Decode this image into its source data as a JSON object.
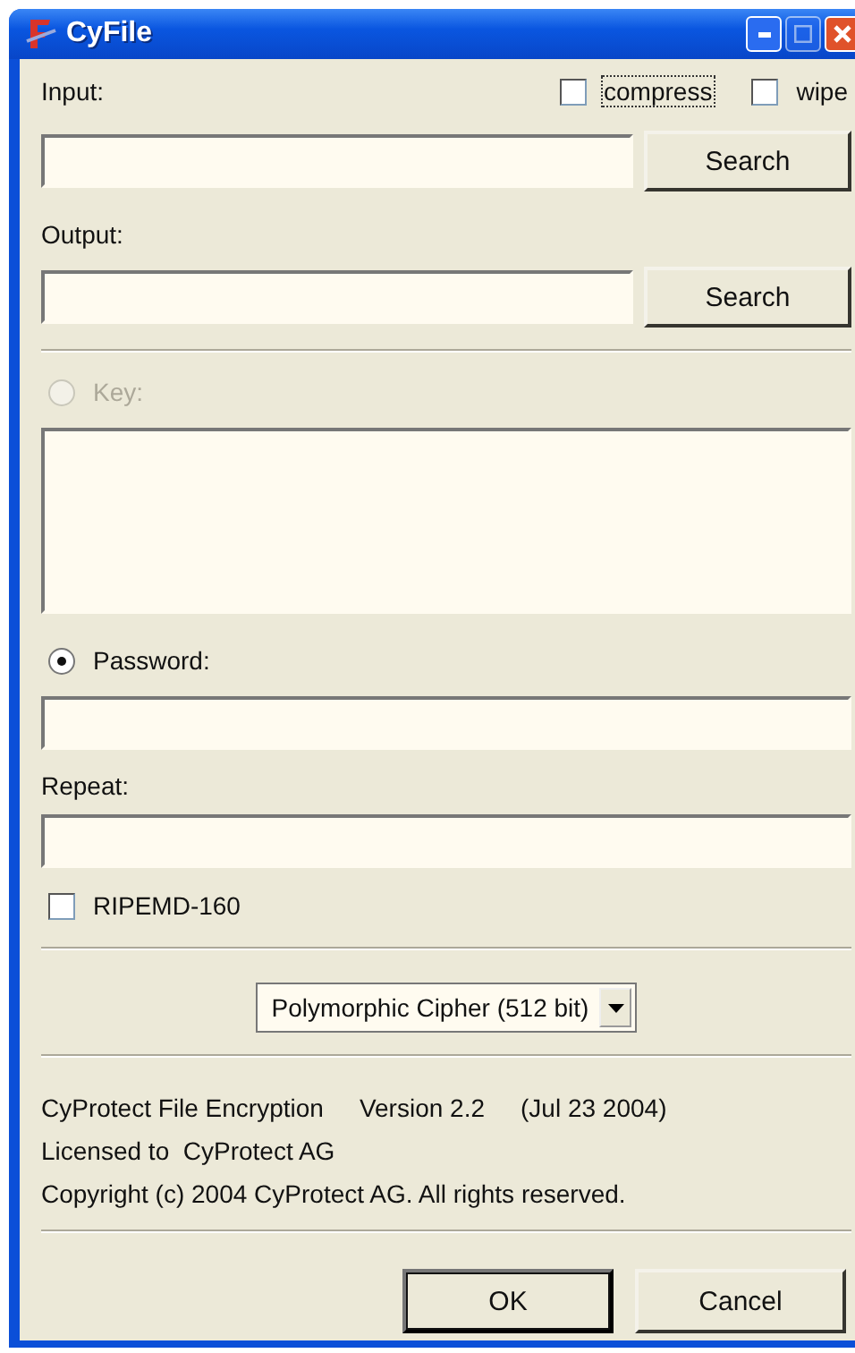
{
  "window": {
    "title": "CyFile",
    "controls": [
      {
        "kind": "minimize"
      },
      {
        "kind": "maximize",
        "disabled": true
      },
      {
        "kind": "close"
      }
    ]
  },
  "input": {
    "label": "Input:",
    "button": "Search"
  },
  "options": [
    {
      "label": "compress",
      "checked": false,
      "focused": true
    },
    {
      "label": "wipe",
      "checked": false,
      "focused": false
    }
  ],
  "output": {
    "label": "Output:",
    "button": "Search"
  },
  "key": {
    "label": "Key:",
    "selected": false,
    "disabled": true
  },
  "password": {
    "label": "Password:",
    "selected": true,
    "disabled": false
  },
  "repeat": {
    "label": "Repeat:"
  },
  "hash": {
    "label": "RIPEMD-160",
    "checked": false
  },
  "cipher": {
    "value": "Polymorphic Cipher (512 bit)"
  },
  "info": {
    "product": "CyProtect File Encryption",
    "version": "Version 2.2",
    "date": "(Jul 23 2004)",
    "license": "Licensed to  CyProtect AG",
    "copyright": "Copyright (c) 2004 CyProtect AG. All rights reserved."
  },
  "buttons": [
    {
      "label": "OK",
      "default": true
    },
    {
      "label": "Cancel",
      "default": false
    }
  ]
}
